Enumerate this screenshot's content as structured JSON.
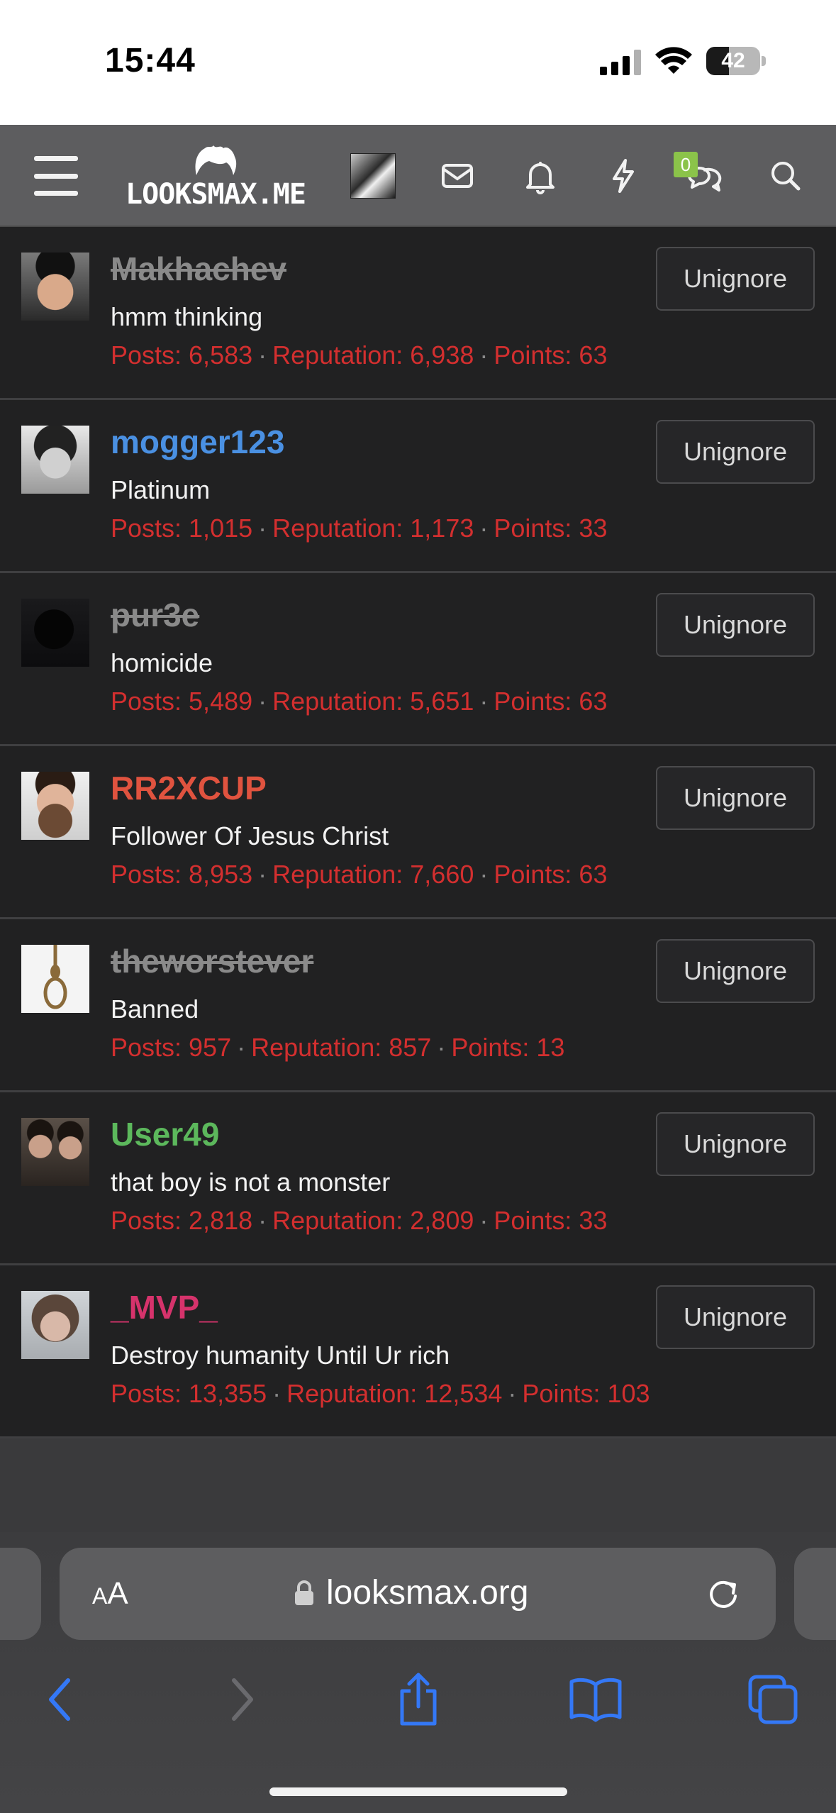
{
  "status_bar": {
    "time": "15:44",
    "battery": "42",
    "battery_level": 0.42
  },
  "header": {
    "logo_text": "LOOKSMAX.ME",
    "conversations_badge": "0"
  },
  "ignored_users": [
    {
      "name": "Makhachev",
      "title": "hmm thinking",
      "posts": "Posts: 6,583",
      "reputation": "Reputation: 6,938",
      "points": "Points: 63",
      "button": "Unignore"
    },
    {
      "name": "mogger123",
      "title": "Platinum",
      "posts": "Posts: 1,015",
      "reputation": "Reputation: 1,173",
      "points": "Points: 33",
      "button": "Unignore"
    },
    {
      "name": "pur3e",
      "title": "homicide",
      "posts": "Posts: 5,489",
      "reputation": "Reputation: 5,651",
      "points": "Points: 63",
      "button": "Unignore"
    },
    {
      "name": "RR2XCUP",
      "title": "Follower Of Jesus Christ",
      "posts": "Posts: 8,953",
      "reputation": "Reputation: 7,660",
      "points": "Points: 63",
      "button": "Unignore"
    },
    {
      "name": "theworstever",
      "title": "Banned",
      "posts": "Posts: 957",
      "reputation": "Reputation: 857",
      "points": "Points: 13",
      "button": "Unignore"
    },
    {
      "name": "User49",
      "title": "that boy is not a monster",
      "posts": "Posts: 2,818",
      "reputation": "Reputation: 2,809",
      "points": "Points: 33",
      "button": "Unignore"
    },
    {
      "name": "_MVP_",
      "title": "Destroy humanity Until Ur rich",
      "posts": "Posts: 13,355",
      "reputation": "Reputation: 12,534",
      "points": "Points: 103",
      "button": "Unignore"
    }
  ],
  "browser": {
    "text_size_small": "A",
    "text_size_large": "A",
    "url": "looksmax.org"
  },
  "colors": {
    "stats_red": "#d32f2f",
    "name_blue": "#4a90e2",
    "name_red": "#e0533f",
    "name_green": "#5cb85c",
    "name_pink": "#d6336c",
    "name_struck_gray": "#8a8a8a",
    "badge_green": "#8bc34a",
    "ios_blue": "#3478f6"
  }
}
